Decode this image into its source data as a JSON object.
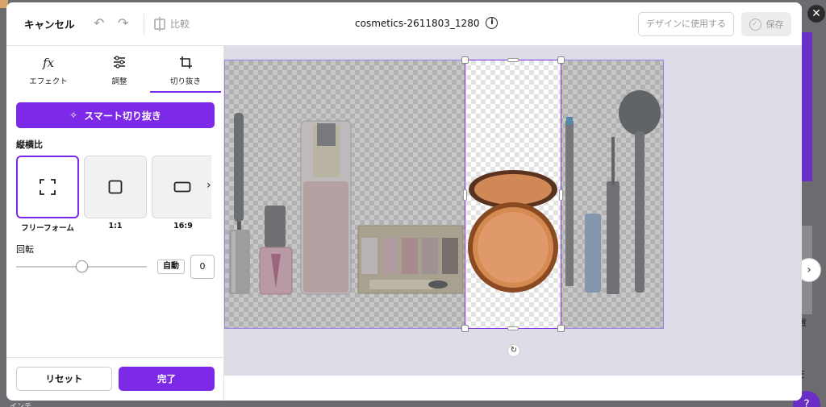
{
  "header": {
    "cancel_label": "キャンセル",
    "compare_label": "比較",
    "filename": "cosmetics-2611803_1280",
    "use_in_design_label": "デザインに使用する",
    "save_label": "保存"
  },
  "tabs": [
    {
      "label": "エフェクト",
      "icon": "fx-icon",
      "glyph": "fx"
    },
    {
      "label": "調整",
      "icon": "sliders-icon",
      "glyph": "☰"
    },
    {
      "label": "切り抜き",
      "icon": "crop-icon",
      "glyph": "⌗"
    }
  ],
  "active_tab": "切り抜き",
  "crop_panel": {
    "smart_crop_label": "スマート切り抜き",
    "aspect_title": "縦横比",
    "ratios": [
      {
        "label": "フリーフォーム",
        "icon": "freeform-icon"
      },
      {
        "label": "1:1",
        "icon": "square-icon"
      },
      {
        "label": "16:9",
        "icon": "wide-rect-icon"
      }
    ],
    "selected_ratio": "フリーフォーム",
    "rotation_title": "回転",
    "auto_label": "自動",
    "rotation_value": "0",
    "reset_label": "リセット",
    "done_label": "完了"
  },
  "colors": {
    "accent": "#7d2ae8",
    "canvas_bg": "#dcdde6"
  },
  "background": {
    "side_text": "置",
    "side_e": "E",
    "bottom_text": "インテ"
  }
}
